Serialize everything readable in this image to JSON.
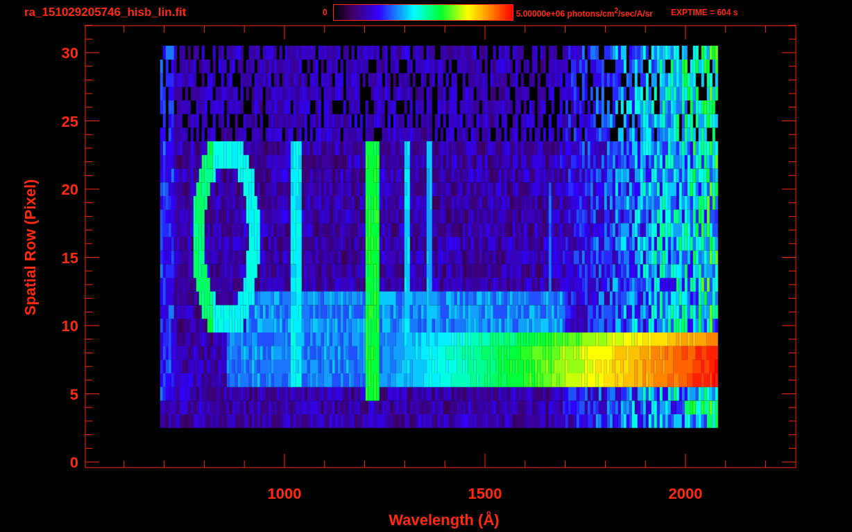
{
  "title": "ra_151029205746_hisb_lin.fit",
  "colorbar": {
    "min_label": "0",
    "max_label": "5.00000e+06 photons/cm$^{2}$/sec/A/sr"
  },
  "exptime": "EXPTIME = 604 s",
  "plot": {
    "xlabel": "Wavelength (Å)",
    "ylabel": "Spatial Row (Pixel)",
    "xticks": [
      "1000",
      "1500",
      "2000"
    ],
    "yticks": [
      "30",
      "25",
      "20",
      "15",
      "10",
      "5",
      "0"
    ]
  }
}
